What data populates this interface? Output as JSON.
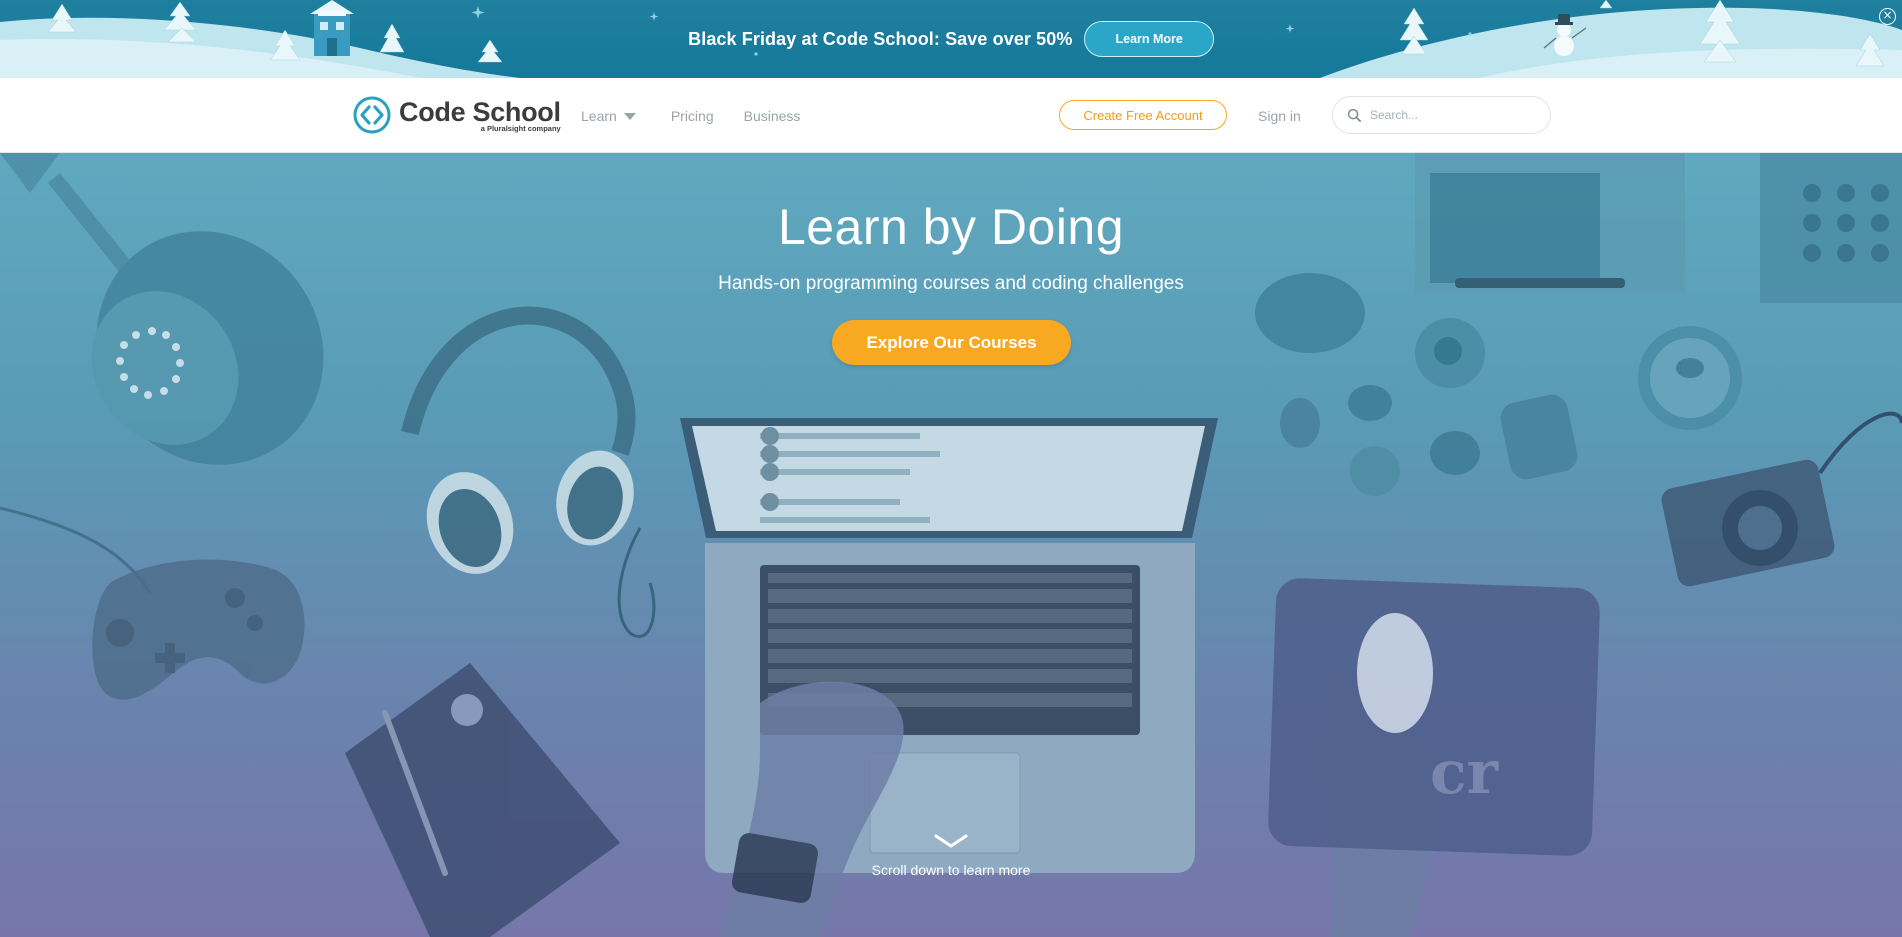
{
  "promo": {
    "text": "Black Friday at Code School: Save over 50%",
    "button_label": "Learn More",
    "close_icon": "close-circle-icon"
  },
  "header": {
    "logo_name": "Code School",
    "logo_sub": "a Pluralsight company",
    "nav": {
      "learn": "Learn",
      "pricing": "Pricing",
      "business": "Business"
    },
    "create_account": "Create Free Account",
    "sign_in": "Sign in",
    "search": {
      "placeholder": "Search...",
      "value": ""
    }
  },
  "hero": {
    "title": "Learn by Doing",
    "subtitle": "Hands-on programming courses and coding challenges",
    "cta": "Explore Our Courses",
    "scroll_text": "Scroll down to learn more"
  },
  "colors": {
    "banner": "#16799a",
    "accent_orange": "#f8a821",
    "logo_teal": "#2aa1c0",
    "nav_gray": "#9aa3a8"
  }
}
